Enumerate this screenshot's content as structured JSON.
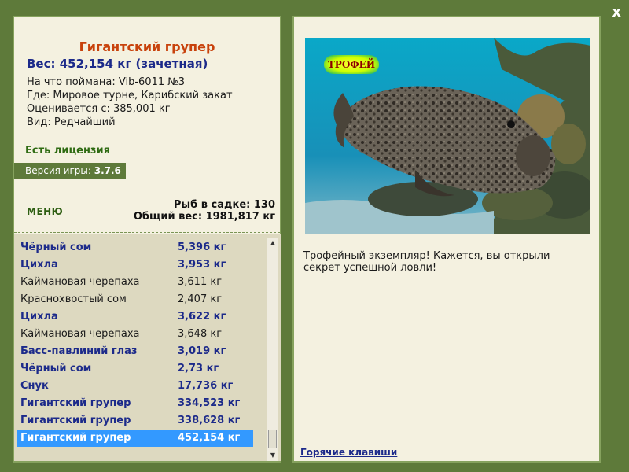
{
  "close_label": "x",
  "catch": {
    "title": "Гигантский групер",
    "weight": "Вес: 452,154 кг (зачетная)",
    "bait": "На что поймана: Vib-6011 №3",
    "location": "Где: Мировое турне, Карибский закат",
    "rated_from": "Оценивается с: 385,001 кг",
    "kind": "Вид: Редчайший"
  },
  "license": "Есть лицензия",
  "version": {
    "label": "Версия игры: ",
    "value": "3.7.6"
  },
  "menu_label": "МЕНЮ",
  "stats": {
    "fish_in_net": "Рыб в садке: 130",
    "total_weight": "Общий вес: 1981,817 кг"
  },
  "fish_list": [
    {
      "name": "Чёрный сом",
      "weight": "5,396 кг",
      "style": "rare"
    },
    {
      "name": "Цихла",
      "weight": "3,953 кг",
      "style": "rare"
    },
    {
      "name": "Каймановая черепаха",
      "weight": "3,611 кг",
      "style": "common"
    },
    {
      "name": "Краснохвостый сом",
      "weight": "2,407 кг",
      "style": "common"
    },
    {
      "name": "Цихла",
      "weight": "3,622 кг",
      "style": "rare"
    },
    {
      "name": "Каймановая черепаха",
      "weight": "3,648 кг",
      "style": "common"
    },
    {
      "name": "Басс-павлиний глаз",
      "weight": "3,019 кг",
      "style": "rare"
    },
    {
      "name": "Чёрный сом",
      "weight": "2,73 кг",
      "style": "rare"
    },
    {
      "name": "Снук",
      "weight": "17,736 кг",
      "style": "rare"
    },
    {
      "name": "Гигантский групер",
      "weight": "334,523 кг",
      "style": "rare"
    },
    {
      "name": "Гигантский групер",
      "weight": "338,628 кг",
      "style": "rare"
    },
    {
      "name": "Гигантский групер",
      "weight": "452,154 кг",
      "style": "sel"
    }
  ],
  "trophy_badge": "ТРОФЕЙ",
  "description": "Трофейный экземпляр! Кажется, вы открыли секрет успешной ловли!",
  "hotkeys_label": "Горячие клавиши",
  "colors": {
    "frame": "#5e7a3a",
    "panel": "#f4f1e0",
    "rare_text": "#1c2a8a",
    "title_text": "#c8420c",
    "selected_row": "#3399ff"
  }
}
